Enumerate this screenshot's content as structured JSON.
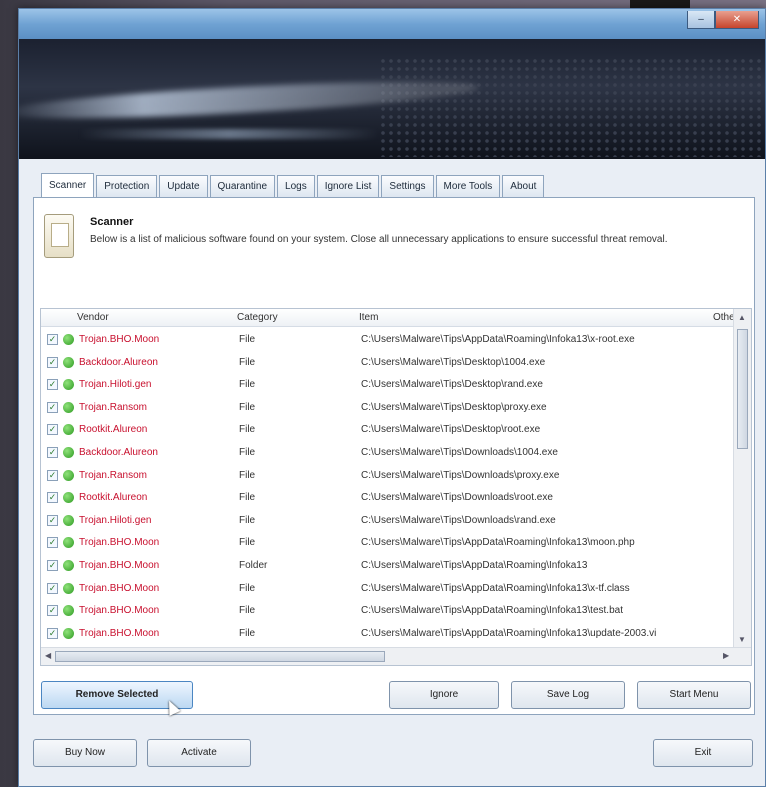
{
  "window": {
    "title": ""
  },
  "banner": {
    "brand": ""
  },
  "tabs": [
    {
      "label": "Scanner",
      "active": true
    },
    {
      "label": "Protection"
    },
    {
      "label": "Update"
    },
    {
      "label": "Quarantine"
    },
    {
      "label": "Logs"
    },
    {
      "label": "Ignore List"
    },
    {
      "label": "Settings"
    },
    {
      "label": "More Tools"
    },
    {
      "label": "About"
    }
  ],
  "info": {
    "title": "Scanner",
    "description": "Below is a list of malicious software found on your system. Close all unnecessary applications to ensure successful threat removal."
  },
  "table": {
    "columns": {
      "vendor": "Vendor",
      "category": "Category",
      "item": "Item",
      "other": "Other"
    },
    "rows": [
      {
        "threat": "Trojan.BHO.Moon",
        "category": "File",
        "item": "C:\\Users\\Malware\\Tips\\AppData\\Roaming\\Infoka13\\x-root.exe"
      },
      {
        "threat": "Backdoor.Alureon",
        "category": "File",
        "item": "C:\\Users\\Malware\\Tips\\Desktop\\1004.exe"
      },
      {
        "threat": "Trojan.Hiloti.gen",
        "category": "File",
        "item": "C:\\Users\\Malware\\Tips\\Desktop\\rand.exe"
      },
      {
        "threat": "Trojan.Ransom",
        "category": "File",
        "item": "C:\\Users\\Malware\\Tips\\Desktop\\proxy.exe"
      },
      {
        "threat": "Rootkit.Alureon",
        "category": "File",
        "item": "C:\\Users\\Malware\\Tips\\Desktop\\root.exe"
      },
      {
        "threat": "Backdoor.Alureon",
        "category": "File",
        "item": "C:\\Users\\Malware\\Tips\\Downloads\\1004.exe"
      },
      {
        "threat": "Trojan.Ransom",
        "category": "File",
        "item": "C:\\Users\\Malware\\Tips\\Downloads\\proxy.exe"
      },
      {
        "threat": "Rootkit.Alureon",
        "category": "File",
        "item": "C:\\Users\\Malware\\Tips\\Downloads\\root.exe"
      },
      {
        "threat": "Trojan.Hiloti.gen",
        "category": "File",
        "item": "C:\\Users\\Malware\\Tips\\Downloads\\rand.exe"
      },
      {
        "threat": "Trojan.BHO.Moon",
        "category": "File",
        "item": "C:\\Users\\Malware\\Tips\\AppData\\Roaming\\Infoka13\\moon.php"
      },
      {
        "threat": "Trojan.BHO.Moon",
        "category": "Folder",
        "item": "C:\\Users\\Malware\\Tips\\AppData\\Roaming\\Infoka13"
      },
      {
        "threat": "Trojan.BHO.Moon",
        "category": "File",
        "item": "C:\\Users\\Malware\\Tips\\AppData\\Roaming\\Infoka13\\x-tf.class"
      },
      {
        "threat": "Trojan.BHO.Moon",
        "category": "File",
        "item": "C:\\Users\\Malware\\Tips\\AppData\\Roaming\\Infoka13\\test.bat"
      },
      {
        "threat": "Trojan.BHO.Moon",
        "category": "File",
        "item": "C:\\Users\\Malware\\Tips\\AppData\\Roaming\\Infoka13\\update-2003.vi"
      }
    ]
  },
  "buttons": {
    "remove_selected": "Remove Selected",
    "ignore": "Ignore",
    "save_log": "Save Log",
    "start_menu": "Start Menu",
    "buy_now": "Buy Now",
    "activate": "Activate",
    "exit": "Exit"
  }
}
